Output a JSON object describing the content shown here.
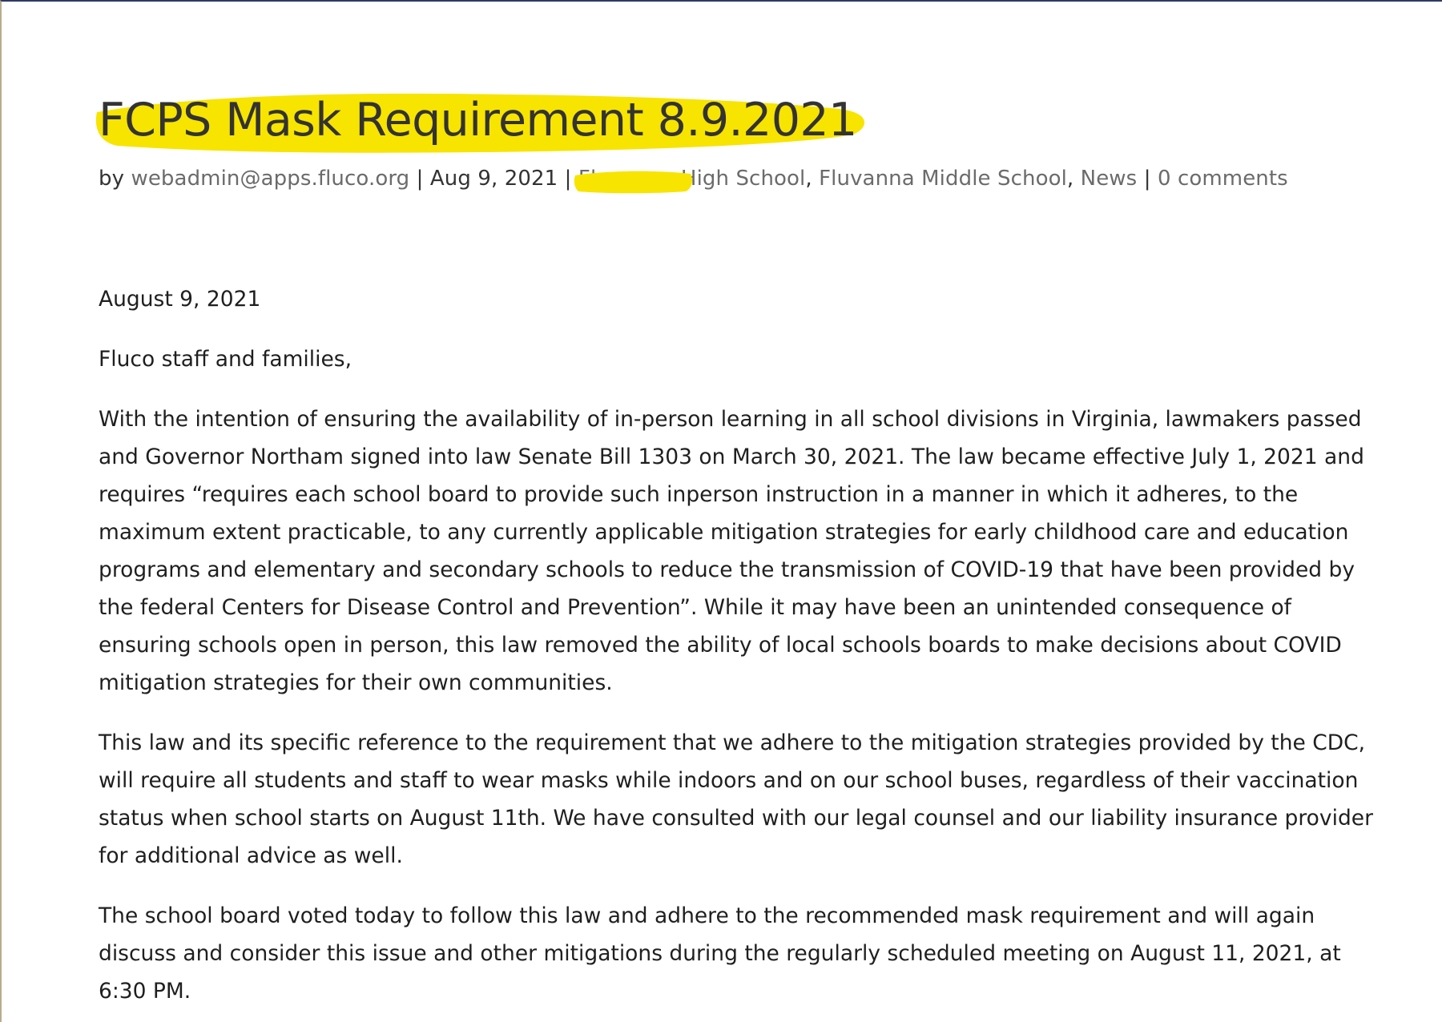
{
  "post": {
    "title": "FCPS Mask Requirement 8.9.2021",
    "meta": {
      "by_label": "by",
      "author": "webadmin@apps.fluco.org",
      "sep1": "|",
      "date": "Aug 9, 2021",
      "sep2": "|",
      "categories": [
        "Fluvanna High School",
        "Fluvanna Middle School",
        "News"
      ],
      "comma1": ",",
      "comma2": ",",
      "sep3": "|",
      "comments": "0 comments"
    },
    "body": {
      "date_line": "August 9, 2021",
      "greeting": "Fluco staff and families,",
      "paragraph_1": "With the intention of ensuring the availability of in-person learning in all school divisions in Virginia, lawmakers passed and Governor Northam signed into law Senate Bill 1303 on March 30, 2021. The law became effective July 1, 2021 and requires “requires each school board to provide such inperson instruction in a manner in which it adheres, to the maximum extent practicable, to any currently applicable mitigation strategies for early childhood care and education programs and elementary and secondary schools to reduce the transmission of COVID-19 that have been provided by the federal Centers for Disease Control and Prevention”. While it may have been an unintended consequence of ensuring schools open in person, this law removed the ability of local schools boards to make decisions about COVID mitigation strategies for their own communities.",
      "paragraph_2": "This law and its specific reference to the requirement that we adhere to the mitigation strategies provided by the CDC, will require all students and staff to wear masks while indoors and on our school buses, regardless of their vaccination status when school starts on August 11th. We have consulted with our legal counsel and our liability insurance provider for additional advice as well.",
      "paragraph_3": "The school board voted today to follow this law and adhere to the recommended mask requirement and will again discuss and consider this issue and other mitigations during the regularly scheduled meeting on August 11, 2021, at 6:30 PM."
    }
  },
  "colors": {
    "highlight": "#f7e400",
    "title_text": "#333333",
    "link_text": "#6b6b6b",
    "body_text": "#1f1f1f",
    "top_border": "#2f3a63",
    "left_border": "#b8ac8e"
  }
}
